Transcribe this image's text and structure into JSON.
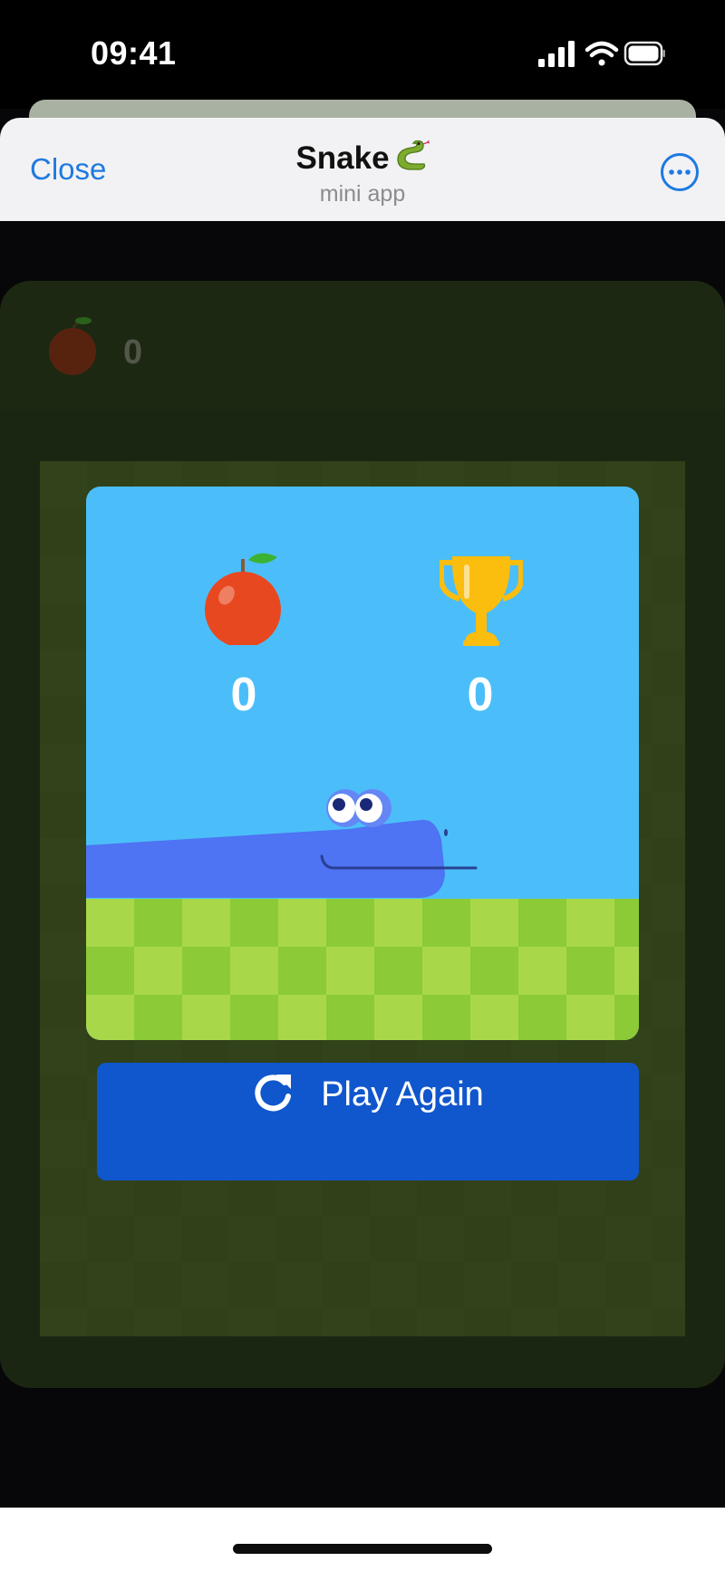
{
  "status_bar": {
    "time": "09:41"
  },
  "header": {
    "close_label": "Close",
    "title": "Snake",
    "title_emoji": "🐍",
    "subtitle": "mini app"
  },
  "score_bar": {
    "apple_count": "0"
  },
  "game_over": {
    "apples_score": "0",
    "best_score": "0",
    "play_again_label": "Play Again"
  },
  "colors": {
    "accent": "#1f7ae0",
    "play_button": "#1056cc",
    "sky": "#4bbef9",
    "snake": "#4e73f3",
    "trophy": "#fbbd0e",
    "apple": "#e8481f"
  },
  "icons": {
    "signal": "cellular-signal-icon",
    "wifi": "wifi-icon",
    "battery": "battery-icon",
    "more": "more-options-icon",
    "apple": "apple-icon",
    "trophy": "trophy-icon",
    "refresh": "refresh-icon"
  }
}
